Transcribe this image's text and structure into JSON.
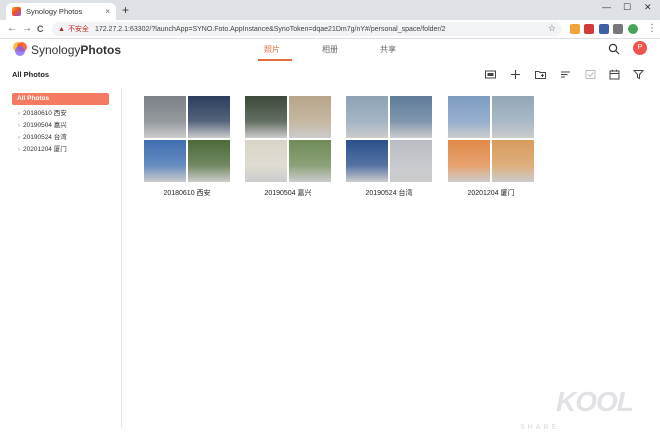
{
  "browser": {
    "tab_title": "Synology Photos",
    "tab_close": "×",
    "new_tab": "+",
    "window_minimize": "—",
    "window_maximize": "☐",
    "window_close": "✕",
    "back": "←",
    "forward": "→",
    "reload": "C",
    "insecure_label": "不安全",
    "url": "172.27.2.1:63302/?launchApp=SYNO.Foto.AppInstance&SynoToken=dqae21Dm7g/nY#/personal_space/folder/2",
    "star": "☆"
  },
  "app": {
    "brand_prefix": "Synology",
    "brand_suffix": "Photos",
    "nav_tabs": [
      {
        "label": "照片",
        "active": true
      },
      {
        "label": "相册",
        "active": false
      },
      {
        "label": "共享",
        "active": false
      }
    ],
    "avatar_letter": "P",
    "accent": "#e26d3a"
  },
  "page": {
    "title": "All Photos"
  },
  "sidebar": {
    "all_label": "All Photos",
    "items": [
      {
        "label": "20180610 西安"
      },
      {
        "label": "20190504 嘉兴"
      },
      {
        "label": "20190524 台湾"
      },
      {
        "label": "20201204 厦门"
      }
    ]
  },
  "folders": [
    {
      "label": "20180610 西安",
      "colors": [
        "#7a8086",
        "#2a3d5c",
        "#3f6fb0",
        "#4d6b3a"
      ]
    },
    {
      "label": "20190504 嘉兴",
      "colors": [
        "#3b4a3a",
        "#b7a58a",
        "#d9d4c7",
        "#6f8a57"
      ]
    },
    {
      "label": "20190524 台湾",
      "colors": [
        "#8ea2b6",
        "#5f7c9a",
        "#2b4f8c",
        "#b9bcc2"
      ]
    },
    {
      "label": "20201204 厦门",
      "colors": [
        "#7d9cc2",
        "#93a7b8",
        "#e08a4a",
        "#d79b5c"
      ]
    }
  ],
  "watermark": {
    "text": "KOOL",
    "sub": "SHARE"
  }
}
